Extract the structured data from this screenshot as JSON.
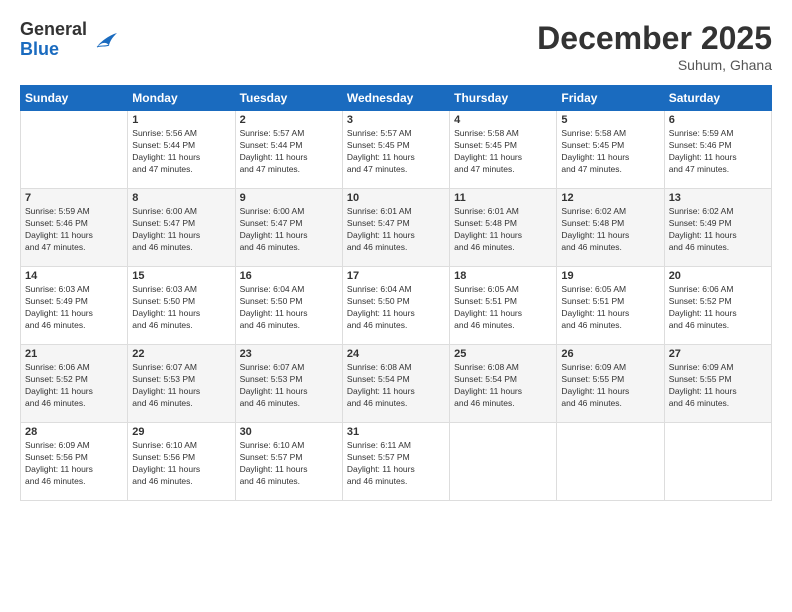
{
  "logo": {
    "general": "General",
    "blue": "Blue"
  },
  "title": "December 2025",
  "location": "Suhum, Ghana",
  "days_header": [
    "Sunday",
    "Monday",
    "Tuesday",
    "Wednesday",
    "Thursday",
    "Friday",
    "Saturday"
  ],
  "weeks": [
    [
      {
        "day": "",
        "info": ""
      },
      {
        "day": "1",
        "info": "Sunrise: 5:56 AM\nSunset: 5:44 PM\nDaylight: 11 hours\nand 47 minutes."
      },
      {
        "day": "2",
        "info": "Sunrise: 5:57 AM\nSunset: 5:44 PM\nDaylight: 11 hours\nand 47 minutes."
      },
      {
        "day": "3",
        "info": "Sunrise: 5:57 AM\nSunset: 5:45 PM\nDaylight: 11 hours\nand 47 minutes."
      },
      {
        "day": "4",
        "info": "Sunrise: 5:58 AM\nSunset: 5:45 PM\nDaylight: 11 hours\nand 47 minutes."
      },
      {
        "day": "5",
        "info": "Sunrise: 5:58 AM\nSunset: 5:45 PM\nDaylight: 11 hours\nand 47 minutes."
      },
      {
        "day": "6",
        "info": "Sunrise: 5:59 AM\nSunset: 5:46 PM\nDaylight: 11 hours\nand 47 minutes."
      }
    ],
    [
      {
        "day": "7",
        "info": "Sunrise: 5:59 AM\nSunset: 5:46 PM\nDaylight: 11 hours\nand 47 minutes."
      },
      {
        "day": "8",
        "info": "Sunrise: 6:00 AM\nSunset: 5:47 PM\nDaylight: 11 hours\nand 46 minutes."
      },
      {
        "day": "9",
        "info": "Sunrise: 6:00 AM\nSunset: 5:47 PM\nDaylight: 11 hours\nand 46 minutes."
      },
      {
        "day": "10",
        "info": "Sunrise: 6:01 AM\nSunset: 5:47 PM\nDaylight: 11 hours\nand 46 minutes."
      },
      {
        "day": "11",
        "info": "Sunrise: 6:01 AM\nSunset: 5:48 PM\nDaylight: 11 hours\nand 46 minutes."
      },
      {
        "day": "12",
        "info": "Sunrise: 6:02 AM\nSunset: 5:48 PM\nDaylight: 11 hours\nand 46 minutes."
      },
      {
        "day": "13",
        "info": "Sunrise: 6:02 AM\nSunset: 5:49 PM\nDaylight: 11 hours\nand 46 minutes."
      }
    ],
    [
      {
        "day": "14",
        "info": "Sunrise: 6:03 AM\nSunset: 5:49 PM\nDaylight: 11 hours\nand 46 minutes."
      },
      {
        "day": "15",
        "info": "Sunrise: 6:03 AM\nSunset: 5:50 PM\nDaylight: 11 hours\nand 46 minutes."
      },
      {
        "day": "16",
        "info": "Sunrise: 6:04 AM\nSunset: 5:50 PM\nDaylight: 11 hours\nand 46 minutes."
      },
      {
        "day": "17",
        "info": "Sunrise: 6:04 AM\nSunset: 5:50 PM\nDaylight: 11 hours\nand 46 minutes."
      },
      {
        "day": "18",
        "info": "Sunrise: 6:05 AM\nSunset: 5:51 PM\nDaylight: 11 hours\nand 46 minutes."
      },
      {
        "day": "19",
        "info": "Sunrise: 6:05 AM\nSunset: 5:51 PM\nDaylight: 11 hours\nand 46 minutes."
      },
      {
        "day": "20",
        "info": "Sunrise: 6:06 AM\nSunset: 5:52 PM\nDaylight: 11 hours\nand 46 minutes."
      }
    ],
    [
      {
        "day": "21",
        "info": "Sunrise: 6:06 AM\nSunset: 5:52 PM\nDaylight: 11 hours\nand 46 minutes."
      },
      {
        "day": "22",
        "info": "Sunrise: 6:07 AM\nSunset: 5:53 PM\nDaylight: 11 hours\nand 46 minutes."
      },
      {
        "day": "23",
        "info": "Sunrise: 6:07 AM\nSunset: 5:53 PM\nDaylight: 11 hours\nand 46 minutes."
      },
      {
        "day": "24",
        "info": "Sunrise: 6:08 AM\nSunset: 5:54 PM\nDaylight: 11 hours\nand 46 minutes."
      },
      {
        "day": "25",
        "info": "Sunrise: 6:08 AM\nSunset: 5:54 PM\nDaylight: 11 hours\nand 46 minutes."
      },
      {
        "day": "26",
        "info": "Sunrise: 6:09 AM\nSunset: 5:55 PM\nDaylight: 11 hours\nand 46 minutes."
      },
      {
        "day": "27",
        "info": "Sunrise: 6:09 AM\nSunset: 5:55 PM\nDaylight: 11 hours\nand 46 minutes."
      }
    ],
    [
      {
        "day": "28",
        "info": "Sunrise: 6:09 AM\nSunset: 5:56 PM\nDaylight: 11 hours\nand 46 minutes."
      },
      {
        "day": "29",
        "info": "Sunrise: 6:10 AM\nSunset: 5:56 PM\nDaylight: 11 hours\nand 46 minutes."
      },
      {
        "day": "30",
        "info": "Sunrise: 6:10 AM\nSunset: 5:57 PM\nDaylight: 11 hours\nand 46 minutes."
      },
      {
        "day": "31",
        "info": "Sunrise: 6:11 AM\nSunset: 5:57 PM\nDaylight: 11 hours\nand 46 minutes."
      },
      {
        "day": "",
        "info": ""
      },
      {
        "day": "",
        "info": ""
      },
      {
        "day": "",
        "info": ""
      }
    ]
  ]
}
